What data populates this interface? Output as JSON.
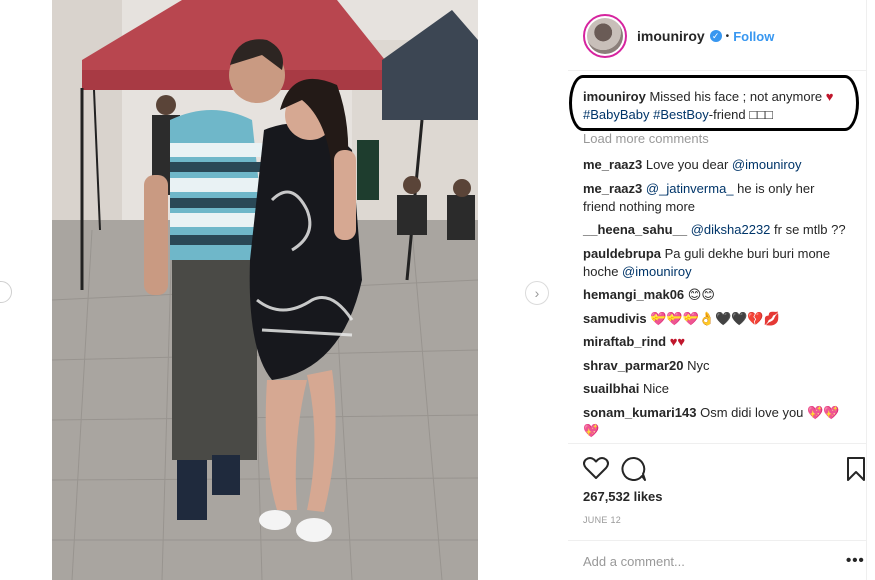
{
  "header": {
    "username": "imouniroy",
    "separator": "•",
    "follow_label": "Follow"
  },
  "caption": {
    "username": "imouniroy",
    "text": "Missed his face ; not anymore",
    "heart": "♥",
    "tag1": "#BabyBaby",
    "tag2": "#BestBoy",
    "rest": "-friend □□□"
  },
  "load_more": "Load more comments",
  "comments": [
    {
      "user": "me_raaz3",
      "text": "Love you dear ",
      "mention": "@imouniroy",
      "after": ""
    },
    {
      "user": "me_raaz3",
      "text": "",
      "mention": "@_jatinverma_",
      "after": " he is only her friend nothing more"
    },
    {
      "user": "__heena_sahu__",
      "text": "",
      "mention": "@diksha2232",
      "after": " fr se mtlb ??"
    },
    {
      "user": "pauldebrupa",
      "text": "Pa guli dekhe buri buri mone hoche ",
      "mention": "@imouniroy",
      "after": ""
    },
    {
      "user": "hemangi_mak06",
      "text": "😊😊",
      "mention": "",
      "after": ""
    },
    {
      "user": "samudivis",
      "text": "💝💝💝👌🖤🖤💔💋",
      "mention": "",
      "after": ""
    },
    {
      "user": "miraftab_rind",
      "text": "♥♥",
      "mention": "",
      "after": ""
    },
    {
      "user": "shrav_parmar20",
      "text": "Nyc",
      "mention": "",
      "after": ""
    },
    {
      "user": "suailbhai",
      "text": "Nice",
      "mention": "",
      "after": ""
    },
    {
      "user": "sonam_kumari143",
      "text": "Osm didi love you 💖💖💖",
      "mention": "",
      "after": ""
    }
  ],
  "likes": "267,532 likes",
  "date": "JUNE 12",
  "add_comment_placeholder": "Add a comment...",
  "more_options": "•••",
  "next_arrow": "›",
  "colors": {
    "link": "#3897f0",
    "tag": "#003569",
    "muted": "#999999",
    "heart": "#c0162c"
  }
}
